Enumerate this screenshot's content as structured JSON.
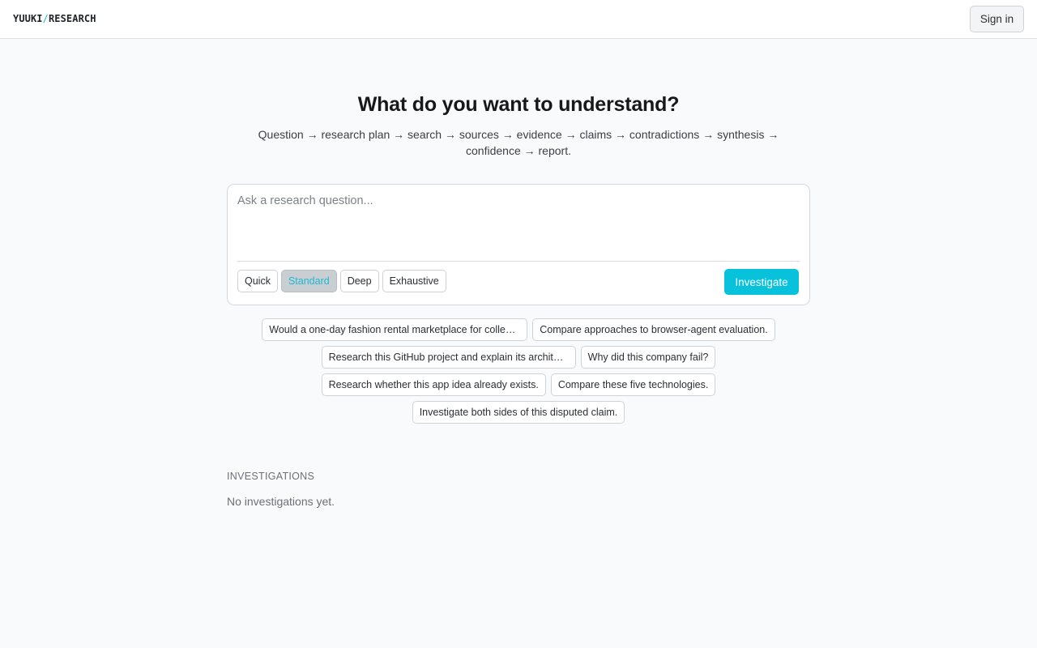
{
  "header": {
    "brand_left": "YUUKI",
    "brand_sep": "/",
    "brand_right": "RESEARCH",
    "signin_label": "Sign in"
  },
  "hero": {
    "title": "What do you want to understand?",
    "subtitle": "Question → research plan → search → sources → evidence → claims → contradictions → synthesis → confidence → report."
  },
  "composer": {
    "placeholder": "Ask a research question...",
    "value": "",
    "depths": [
      "Quick",
      "Standard",
      "Deep",
      "Exhaustive"
    ],
    "selected_depth": "Standard",
    "submit_label": "Investigate"
  },
  "suggestions": [
    "Would a one-day fashion rental marketplace for college…",
    "Compare approaches to browser-agent evaluation.",
    "Research this GitHub project and explain its architect…",
    "Why did this company fail?",
    "Research whether this app idea already exists.",
    "Compare these five technologies.",
    "Investigate both sides of this disputed claim."
  ],
  "investigations": {
    "label": "INVESTIGATIONS",
    "empty_text": "No investigations yet."
  },
  "colors": {
    "accent": "#08c2dc",
    "background": "#f9fafb",
    "selected_depth_bg": "#c9ced3"
  }
}
